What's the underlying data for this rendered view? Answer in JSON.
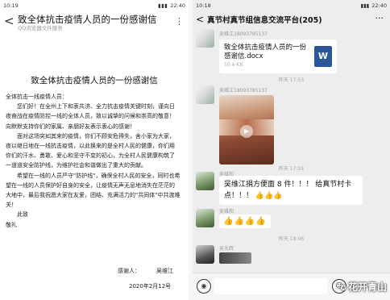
{
  "left": {
    "status": {
      "time": "10:19",
      "right": "22:40"
    },
    "header": {
      "title": "致全体抗击疫情人员的一份感谢信",
      "subtitle": "QQ浏览器文件服务",
      "back_glyph": "<",
      "more_glyph": "⋮"
    },
    "document": {
      "title": "致全体抗击疫情人员的一份感谢信",
      "lines": [
        "全体抗击一线疫情人员：",
        "您们好！在全州上下和衷共济、全力抗击疫情关键时刻，谨向日",
        "夜奋战在疫情防控一线的全体人员，致以诚挚的问候和崇高的敬意！",
        "向默默支持你们的家属、亲朋好友表示衷心的感谢！",
        "面对这场突如其来的疫情，你们不顾安危得失，舍小家为大家，",
        "夜以继日地在一线抗击疫情，以此换来的是全村人民的健康，你们用",
        "你们的汗水、勇敢、爱心和坚守不变的初心，为全村人民健康构筑了",
        "一道道安全防护线，为维护社会和谐做出了重大的贡献。",
        "希望在一线的人员严守\"防护线\"，确保全村人民的安全，同时也希",
        "望在一线的人员保护好自身的安全，让疫情无声无息地消失在茫茫的",
        "大地中，最后我祝愿大家在友爱，团结、充满活力的\"共同体\"中共渡难",
        "关！",
        "此致",
        "敬礼"
      ],
      "signer_label": "感谢人：",
      "signer_name": "吴维江",
      "date": "2020年2月12号"
    }
  },
  "right": {
    "status": {
      "time": "10:18",
      "right": "22:40"
    },
    "header": {
      "title": "真节村真节组信息交流平台(205)",
      "back_glyph": "<",
      "more_glyph": "···"
    },
    "messages": {
      "m1_sender": "吴维江18093785137",
      "file_name": "致全体抗击疫情人员的一份感谢信.docx",
      "file_size": "10.4 KB",
      "file_icon_letter": "W",
      "time1": "昨天 17:53",
      "m2_sender": "吴维江18093785137",
      "play_glyph": "▶",
      "time2": "昨天 17:55",
      "m3_sender": "吴维和",
      "text_bubble": "吴维江捐方便面 8 件！！！ 给真节村卡点！！！ 👍👍👍",
      "m4_sender": "吴维和",
      "emoji_bubble": "👍👍👍👍",
      "time3": "昨天 18:06",
      "m5_sender": "吴光辉"
    },
    "input": {
      "voice_glyph": "◉",
      "emoji_glyph": "☺"
    },
    "watermark": "花开青山",
    "watermark_icon": "✪"
  },
  "colors": {
    "wechat_bg": "#ededed",
    "word_blue": "#2b579a"
  }
}
